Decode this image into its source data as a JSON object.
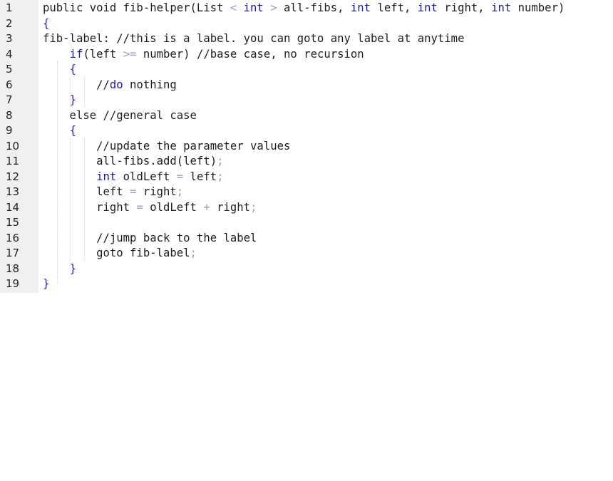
{
  "editor": {
    "lines": [
      {
        "number": "1",
        "tokens": [
          {
            "t": "public void fib-helper(List ",
            "c": "tx"
          },
          {
            "t": "<",
            "c": "op"
          },
          {
            "t": " ",
            "c": "tx"
          },
          {
            "t": "int",
            "c": "kw"
          },
          {
            "t": " ",
            "c": "tx"
          },
          {
            "t": ">",
            "c": "op"
          },
          {
            "t": " all-fibs, ",
            "c": "tx"
          },
          {
            "t": "int",
            "c": "kw"
          },
          {
            "t": " left, ",
            "c": "tx"
          },
          {
            "t": "int",
            "c": "kw"
          },
          {
            "t": " right, ",
            "c": "tx"
          },
          {
            "t": "int",
            "c": "kw"
          },
          {
            "t": " number)",
            "c": "tx"
          }
        ]
      },
      {
        "number": "2",
        "tokens": [
          {
            "t": "{",
            "c": "pu"
          }
        ]
      },
      {
        "number": "3",
        "tokens": [
          {
            "t": "fib-label: //this is a label. you can goto any label at anytime",
            "c": "tx"
          }
        ]
      },
      {
        "number": "4",
        "tokens": [
          {
            "t": "    ",
            "c": "tx"
          },
          {
            "t": "if",
            "c": "kw"
          },
          {
            "t": "(left ",
            "c": "tx"
          },
          {
            "t": ">=",
            "c": "op"
          },
          {
            "t": " number) //base case, no recursion",
            "c": "tx"
          }
        ]
      },
      {
        "number": "5",
        "tokens": [
          {
            "t": "    ",
            "c": "tx"
          },
          {
            "t": "{",
            "c": "pu"
          }
        ]
      },
      {
        "number": "6",
        "tokens": [
          {
            "t": "        //",
            "c": "tx"
          },
          {
            "t": "do",
            "c": "kw"
          },
          {
            "t": " nothing",
            "c": "tx"
          }
        ]
      },
      {
        "number": "7",
        "tokens": [
          {
            "t": "    ",
            "c": "tx"
          },
          {
            "t": "}",
            "c": "pu"
          }
        ]
      },
      {
        "number": "8",
        "tokens": [
          {
            "t": "    else //general case",
            "c": "tx"
          }
        ]
      },
      {
        "number": "9",
        "tokens": [
          {
            "t": "    ",
            "c": "tx"
          },
          {
            "t": "{",
            "c": "pu"
          }
        ]
      },
      {
        "number": "10",
        "tokens": [
          {
            "t": "        //update the parameter values",
            "c": "tx"
          }
        ]
      },
      {
        "number": "11",
        "tokens": [
          {
            "t": "        all-fibs.add(left)",
            "c": "tx"
          },
          {
            "t": ";",
            "c": "op"
          }
        ]
      },
      {
        "number": "12",
        "tokens": [
          {
            "t": "        ",
            "c": "tx"
          },
          {
            "t": "int",
            "c": "kw"
          },
          {
            "t": " oldLeft ",
            "c": "tx"
          },
          {
            "t": "=",
            "c": "op"
          },
          {
            "t": " left",
            "c": "tx"
          },
          {
            "t": ";",
            "c": "op"
          }
        ]
      },
      {
        "number": "13",
        "tokens": [
          {
            "t": "        left ",
            "c": "tx"
          },
          {
            "t": "=",
            "c": "op"
          },
          {
            "t": " right",
            "c": "tx"
          },
          {
            "t": ";",
            "c": "op"
          }
        ]
      },
      {
        "number": "14",
        "tokens": [
          {
            "t": "        right ",
            "c": "tx"
          },
          {
            "t": "=",
            "c": "op"
          },
          {
            "t": " oldLeft ",
            "c": "tx"
          },
          {
            "t": "+",
            "c": "op"
          },
          {
            "t": " right",
            "c": "tx"
          },
          {
            "t": ";",
            "c": "op"
          }
        ]
      },
      {
        "number": "15",
        "tokens": []
      },
      {
        "number": "16",
        "tokens": [
          {
            "t": "        //jump back to the label",
            "c": "tx"
          }
        ]
      },
      {
        "number": "17",
        "tokens": [
          {
            "t": "        goto fib-label",
            "c": "tx"
          },
          {
            "t": ";",
            "c": "op"
          }
        ]
      },
      {
        "number": "18",
        "tokens": [
          {
            "t": "    ",
            "c": "tx"
          },
          {
            "t": "}",
            "c": "pu"
          }
        ]
      },
      {
        "number": "19",
        "tokens": [
          {
            "t": "}",
            "c": "pu"
          }
        ]
      }
    ]
  },
  "colors": {
    "gutter_bg": "#f0f0f0",
    "text": "#1e1e1e",
    "keyword": "#1a1aa6",
    "operator": "#9a9ac8",
    "brace": "#2a2ab0"
  }
}
